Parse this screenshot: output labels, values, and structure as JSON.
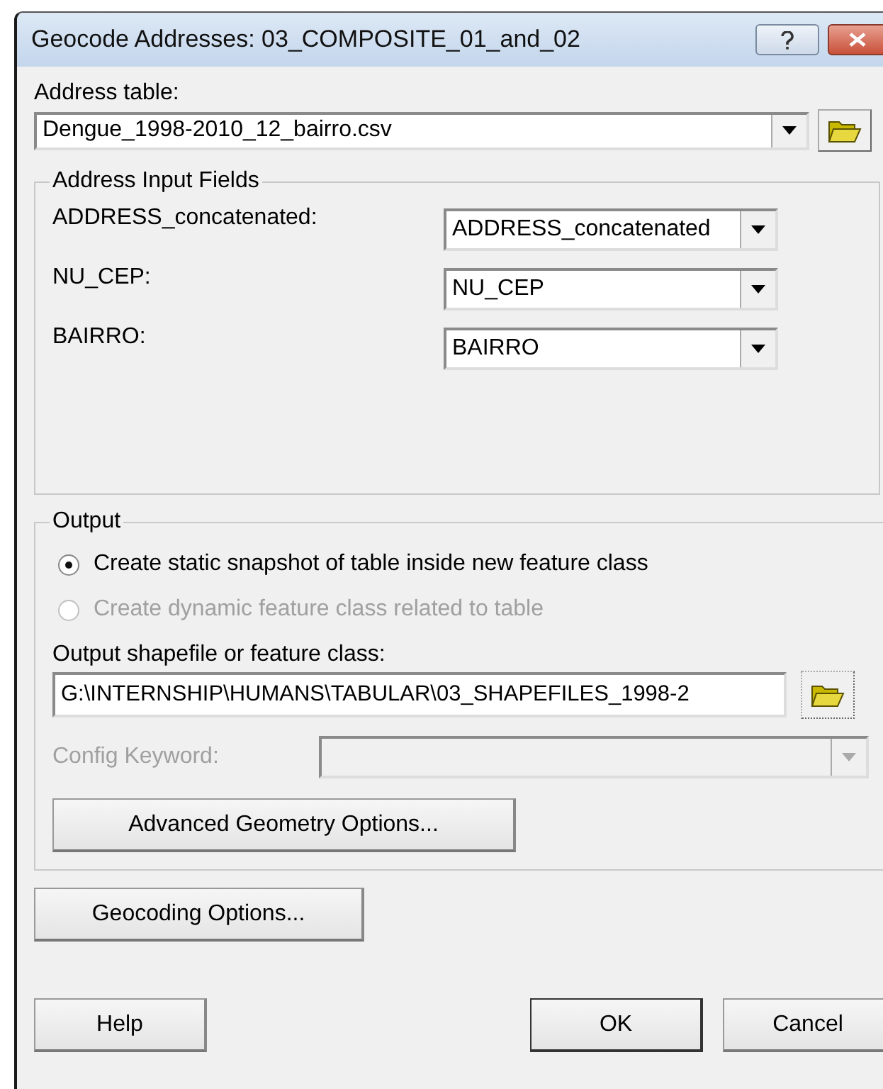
{
  "window": {
    "title": "Geocode Addresses:  03_COMPOSITE_01_and_02"
  },
  "address_table": {
    "label": "Address table:",
    "value": "Dengue_1998-2010_12_bairro.csv"
  },
  "address_input_fields": {
    "title": "Address Input Fields",
    "fields": [
      {
        "label": "ADDRESS_concatenated:",
        "value": "ADDRESS_concatenated"
      },
      {
        "label": "NU_CEP:",
        "value": "NU_CEP"
      },
      {
        "label": "BAIRRO:",
        "value": "BAIRRO"
      }
    ]
  },
  "output": {
    "title": "Output",
    "options": [
      {
        "label": "Create static snapshot of table inside new feature class",
        "selected": true,
        "disabled": false
      },
      {
        "label": "Create dynamic feature class related to table",
        "selected": false,
        "disabled": true
      }
    ],
    "output_label": "Output shapefile or feature class:",
    "output_value": "G:\\INTERNSHIP\\HUMANS\\TABULAR\\03_SHAPEFILES_1998-2",
    "config_keyword": {
      "label": "Config Keyword:",
      "disabled": true
    },
    "advanced_button": "Advanced Geometry Options..."
  },
  "geocoding_button": "Geocoding Options...",
  "buttons": [
    {
      "label": "Help",
      "default": false
    },
    {
      "label": "OK",
      "default": true
    },
    {
      "label": "Cancel",
      "default": false
    }
  ]
}
